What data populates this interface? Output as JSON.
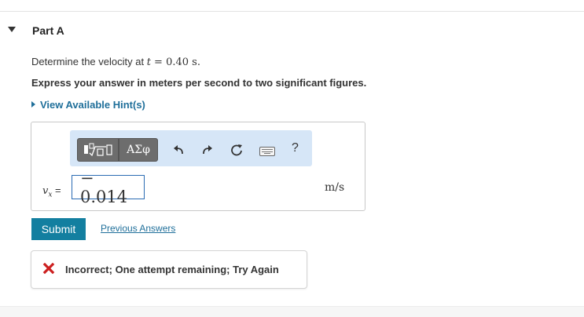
{
  "part": {
    "title": "Part A"
  },
  "question": {
    "prefix": "Determine the velocity at ",
    "var": "t",
    "eq": " = 0.40 s.",
    "instruction": "Express your answer in meters per second to two significant figures.",
    "hint_link": "View Available Hint(s)"
  },
  "toolbar": {
    "templates_icon": "fraction-root-template-icon",
    "symbols_label": "ΑΣφ",
    "undo_icon": "undo-icon",
    "redo_icon": "redo-icon",
    "reset_icon": "reset-icon",
    "keyboard_icon": "keyboard-icon",
    "help_label": "?"
  },
  "answer": {
    "variable": "v",
    "subscript": "x",
    "equals": " =",
    "value": "− 0.014",
    "units": "m/s"
  },
  "actions": {
    "submit_label": "Submit",
    "previous_answers_label": "Previous Answers"
  },
  "feedback": {
    "text": "Incorrect; One attempt remaining; Try Again",
    "status_color": "#cc1f1f"
  },
  "colors": {
    "accent": "#137fa0",
    "link": "#1f6f9a",
    "toolbar_bg": "#d6e6f7",
    "input_border": "#2a6bb3"
  }
}
